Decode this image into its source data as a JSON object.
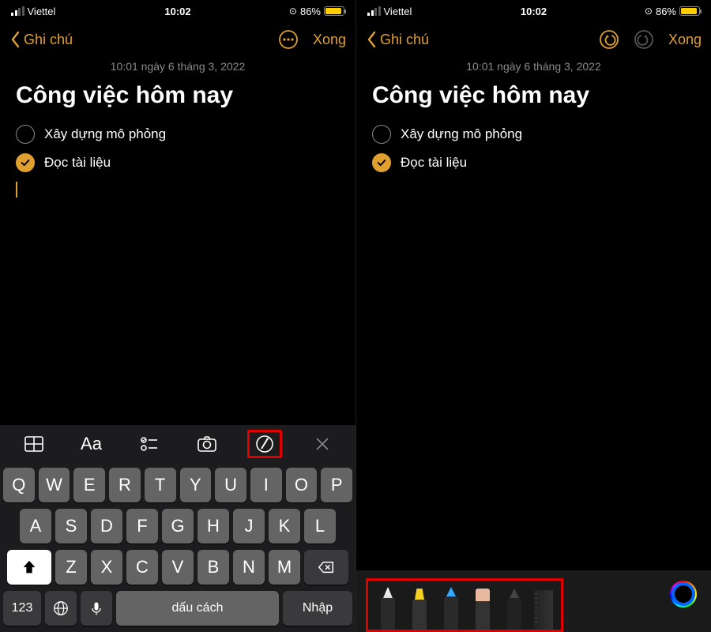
{
  "status": {
    "carrier": "Viettel",
    "time": "10:02",
    "battery_pct": "86%"
  },
  "nav": {
    "back_label": "Ghi chú",
    "done_label": "Xong"
  },
  "note": {
    "timestamp": "10:01 ngày 6 tháng 3, 2022",
    "title": "Công việc hôm nay",
    "items": [
      {
        "text": "Xây dựng mô phỏng",
        "checked": false
      },
      {
        "text": "Đọc tài liệu",
        "checked": true
      }
    ]
  },
  "toolbar": {
    "text_format": "Aa"
  },
  "keyboard": {
    "row1": [
      "Q",
      "W",
      "E",
      "R",
      "T",
      "Y",
      "U",
      "I",
      "O",
      "P"
    ],
    "row2": [
      "A",
      "S",
      "D",
      "F",
      "G",
      "H",
      "J",
      "K",
      "L"
    ],
    "row3": [
      "Z",
      "X",
      "C",
      "V",
      "B",
      "N",
      "M"
    ],
    "num_label": "123",
    "space_label": "dấu cách",
    "enter_label": "Nhập"
  }
}
